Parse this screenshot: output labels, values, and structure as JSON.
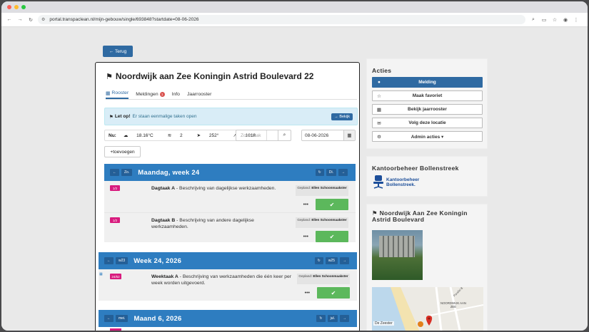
{
  "browser": {
    "url": "portal.transpaclean.nl/mijn-gebouw/single/693848?startdate=08-06-2026",
    "traffic_colors": [
      "#ff5f57",
      "#febc2e",
      "#28c840"
    ]
  },
  "back_button": "← Terug",
  "building": {
    "title": "Noordwijk aan Zee Koningin Astrid Boulevard 22",
    "tabs": [
      {
        "label": "Rooster",
        "active": true
      },
      {
        "label": "Meldingen",
        "badge": "1"
      },
      {
        "label": "Info"
      },
      {
        "label": "Jaarrooster"
      }
    ]
  },
  "alert": {
    "strong": "Let op!",
    "text": "Er staan eenmalige taken open",
    "button": "→ Bekijk"
  },
  "weather": {
    "label": "Nu:",
    "temp": "18.16°C",
    "wind_force": "2",
    "wind_dir": "252°",
    "pressure": "1018"
  },
  "search": {
    "placeholder": "Zoek taak"
  },
  "date": {
    "value": "08-06-2026"
  },
  "add_button": "+toevoegen",
  "sections": [
    {
      "prev": "←",
      "prev_label": "Zo.",
      "title": "Maandag, week 24",
      "refresh": "↻",
      "next_label": "Di.",
      "next": "→",
      "tasks": [
        {
          "tag": "1/2",
          "name": "Dagtaak A",
          "desc": " - Beschrijving van dagelijkse werkzaamheden.",
          "planned_label": "Gepland:",
          "planned_who": "Ellen Schoonmaakster",
          "more": "•••",
          "check": "✔"
        },
        {
          "tag": "1/2",
          "name": "Dagtaak B",
          "desc": " - Beschrijving van andere dagelijkse werkzaamheden.",
          "planned_label": "Gepland:",
          "planned_who": "Ellen Schoonmaakster",
          "more": "•••",
          "check": "✔"
        }
      ]
    },
    {
      "prev": "←",
      "prev_label": "w23",
      "title": "Week 24, 2026",
      "refresh": "↻",
      "next_label": "w25",
      "next": "→",
      "tasks": [
        {
          "tag": "24/52",
          "name": "Weektaak A",
          "desc": " - Beschrijving van werkzaamheden die één keer per week worden uitgevoerd.",
          "planned_label": "Gepland:",
          "planned_who": "Ellen Schoonmaakster",
          "more": "•••",
          "check": "✔"
        }
      ]
    },
    {
      "prev": "←",
      "prev_label": "mei.",
      "title": "Maand 6, 2026",
      "refresh": "↻",
      "next_label": "jul.",
      "next": "→"
    }
  ],
  "sidebar": {
    "actions_title": "Acties",
    "actions": [
      {
        "label": "Melding",
        "icon": "chat-icon"
      },
      {
        "label": "Maak favoriet",
        "icon": "star-icon"
      },
      {
        "label": "Bekijk jaarrooster",
        "icon": "calendar-icon"
      },
      {
        "label": "Volg deze locatie",
        "icon": "envelope-icon"
      },
      {
        "label": "Admin acties ▾",
        "icon": "gear-icon"
      }
    ],
    "company_title": "Kantoorbeheer Bollenstreek",
    "company_logo_text": [
      "Kantoorbeheer",
      "Bollenstreek."
    ],
    "location_title": "Noordwijk Aan Zee Koningin Astrid Boulevard",
    "map_labels": {
      "poi": "De Zeester",
      "area": "NOORDWIJK AAN ZEE",
      "street": "Parallel B"
    }
  }
}
